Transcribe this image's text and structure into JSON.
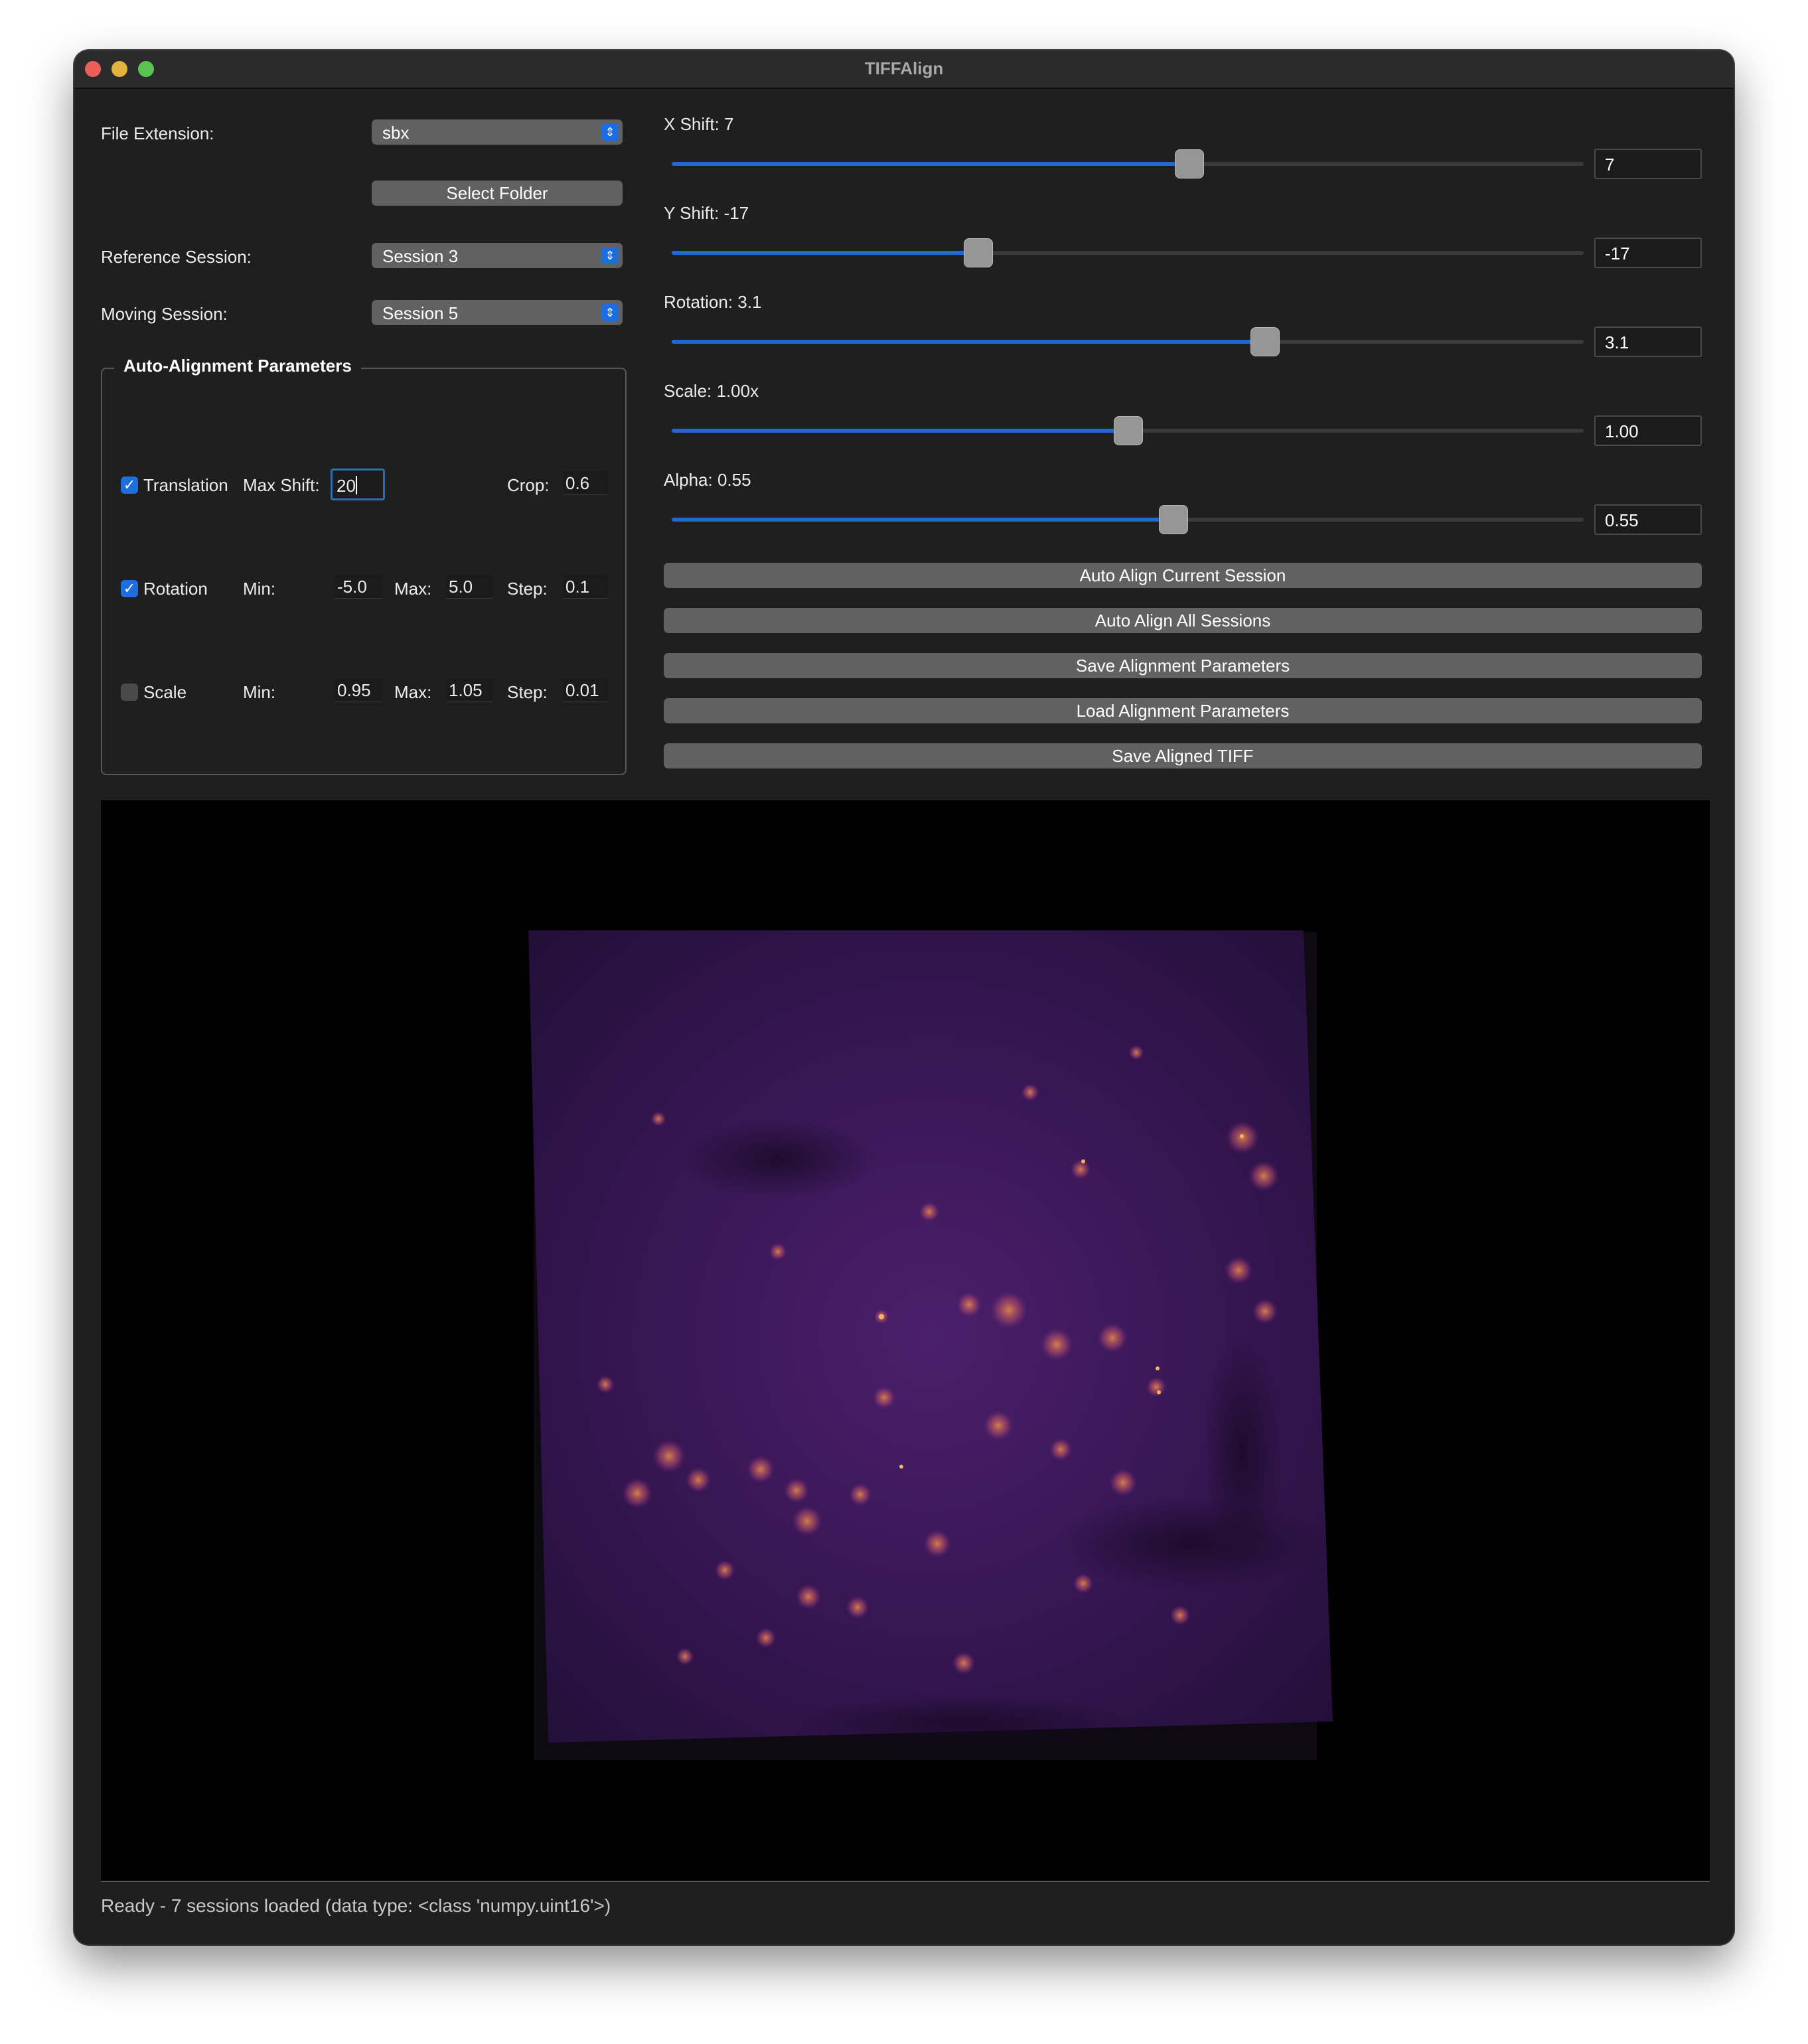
{
  "window": {
    "title": "TIFFAlign"
  },
  "left_panel": {
    "file_extension_label": "File Extension:",
    "file_extension_value": "sbx",
    "select_folder_label": "Select Folder",
    "reference_session_label": "Reference Session:",
    "reference_session_value": "Session 3",
    "moving_session_label": "Moving Session:",
    "moving_session_value": "Session 5"
  },
  "auto_alignment": {
    "title": "Auto-Alignment Parameters",
    "translation": {
      "label": "Translation",
      "checked": true,
      "max_shift_label": "Max Shift:",
      "max_shift_value": "20",
      "crop_label": "Crop:",
      "crop_value": "0.6"
    },
    "rotation": {
      "label": "Rotation",
      "checked": true,
      "min_label": "Min:",
      "min_value": "-5.0",
      "max_label": "Max:",
      "max_value": "5.0",
      "step_label": "Step:",
      "step_value": "0.1"
    },
    "scale": {
      "label": "Scale",
      "checked": false,
      "min_label": "Min:",
      "min_value": "0.95",
      "max_label": "Max:",
      "max_value": "1.05",
      "step_label": "Step:",
      "step_value": "0.01"
    }
  },
  "sliders": {
    "x_shift": {
      "label": "X Shift: 7",
      "value": "7",
      "fraction": 0.568
    },
    "y_shift": {
      "label": "Y Shift: -17",
      "value": "-17",
      "fraction": 0.336
    },
    "rotation": {
      "label": "Rotation: 3.1",
      "value": "3.1",
      "fraction": 0.651
    },
    "scale": {
      "label": "Scale: 1.00x",
      "value": "1.00",
      "fraction": 0.501
    },
    "alpha": {
      "label": "Alpha: 0.55",
      "value": "0.55",
      "fraction": 0.55
    }
  },
  "actions": {
    "auto_align_current": "Auto Align Current Session",
    "auto_align_all": "Auto Align All Sessions",
    "save_params": "Save Alignment Parameters",
    "load_params": "Load Alignment Parameters",
    "save_tiff": "Save Aligned TIFF"
  },
  "status_bar": {
    "text": "Ready - 7 sessions loaded (data type: <class 'numpy.uint16'>)"
  },
  "colors": {
    "accent": "#2268d4",
    "window_bg": "#1f1f1f",
    "button_bg": "#616161",
    "image_tint": "#3a1656"
  }
}
